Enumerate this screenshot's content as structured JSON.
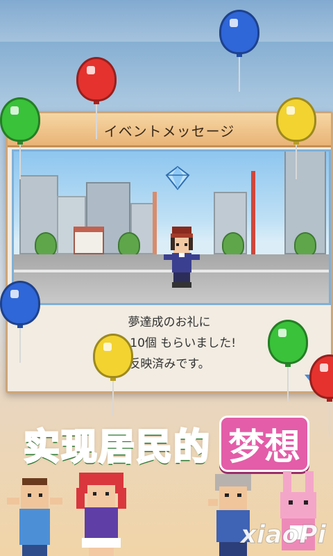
{
  "dialog": {
    "title": "イベントメッセージ",
    "message_line1": "夢達成のお礼に",
    "message_line2": "ダー 10個 もらいました!",
    "message_line3": "反映済みです。"
  },
  "banner": {
    "main_text": "实现居民的",
    "accent_text": "梦想"
  },
  "colors": {
    "dialog_header": "#e9b477",
    "banner_green": "#3ec74a",
    "banner_pink": "#e35da8",
    "balloon_red": "#e5322e",
    "balloon_blue": "#2f66d8",
    "balloon_green": "#39c23a",
    "balloon_yellow": "#f2d330"
  },
  "watermark": "xiaoPi"
}
